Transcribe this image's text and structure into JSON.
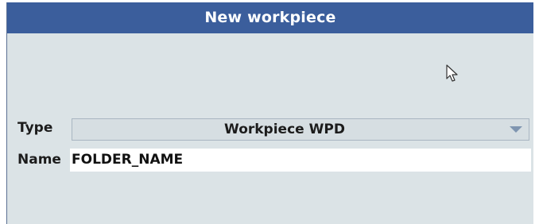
{
  "dialog": {
    "title": "New workpiece",
    "accent_color": "#3b5e9c",
    "background_color": "#dbe3e6"
  },
  "fields": {
    "type": {
      "label": "Type",
      "selected_value": "Workpiece WPD"
    },
    "name": {
      "label": "Name",
      "value": "FOLDER_NAME"
    }
  },
  "icons": {
    "cursor": "mouse-pointer-icon",
    "dropdown": "chevron-down-icon"
  }
}
